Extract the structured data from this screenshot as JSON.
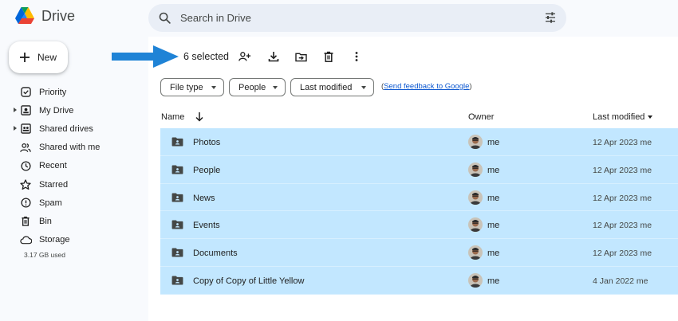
{
  "app": {
    "title": "Drive"
  },
  "search": {
    "placeholder": "Search in Drive"
  },
  "new_button": {
    "label": "New"
  },
  "sidebar": {
    "items": [
      {
        "label": "Priority",
        "icon": "priority-icon",
        "expandable": false
      },
      {
        "label": "My Drive",
        "icon": "my-drive-icon",
        "expandable": true
      },
      {
        "label": "Shared drives",
        "icon": "shared-drives-icon",
        "expandable": true
      },
      {
        "label": "Shared with me",
        "icon": "shared-with-me-icon",
        "expandable": false
      },
      {
        "label": "Recent",
        "icon": "clock-icon",
        "expandable": false
      },
      {
        "label": "Starred",
        "icon": "star-icon",
        "expandable": false
      },
      {
        "label": "Spam",
        "icon": "spam-icon",
        "expandable": false
      },
      {
        "label": "Bin",
        "icon": "trash-icon",
        "expandable": false
      },
      {
        "label": "Storage",
        "icon": "cloud-icon",
        "expandable": false
      }
    ],
    "storage_used": "3.17 GB used"
  },
  "toolbar": {
    "selected_text": "6 selected",
    "actions": [
      "share-icon",
      "download-icon",
      "move-icon",
      "trash-icon",
      "more-vert-icon"
    ]
  },
  "filters": {
    "chips": [
      "File type",
      "People",
      "Last modified"
    ],
    "feedback_link": "Send feedback to Google"
  },
  "table": {
    "columns": {
      "name": "Name",
      "owner": "Owner",
      "modified": "Last modified"
    },
    "rows": [
      {
        "name": "Photos",
        "owner": "me",
        "modified": "12 Apr 2023 me"
      },
      {
        "name": "People",
        "owner": "me",
        "modified": "12 Apr 2023 me"
      },
      {
        "name": "News",
        "owner": "me",
        "modified": "12 Apr 2023 me"
      },
      {
        "name": "Events",
        "owner": "me",
        "modified": "12 Apr 2023 me"
      },
      {
        "name": "Documents",
        "owner": "me",
        "modified": "12 Apr 2023 me"
      },
      {
        "name": "Copy of Copy of Little Yellow",
        "owner": "me",
        "modified": "4 Jan 2022 me"
      }
    ]
  },
  "colors": {
    "selection": "#c2e7ff",
    "sidebar_bg": "#f8fafd",
    "search_bg": "#e9eef6",
    "callout_arrow": "#1f83d6",
    "link": "#0b57d0"
  }
}
